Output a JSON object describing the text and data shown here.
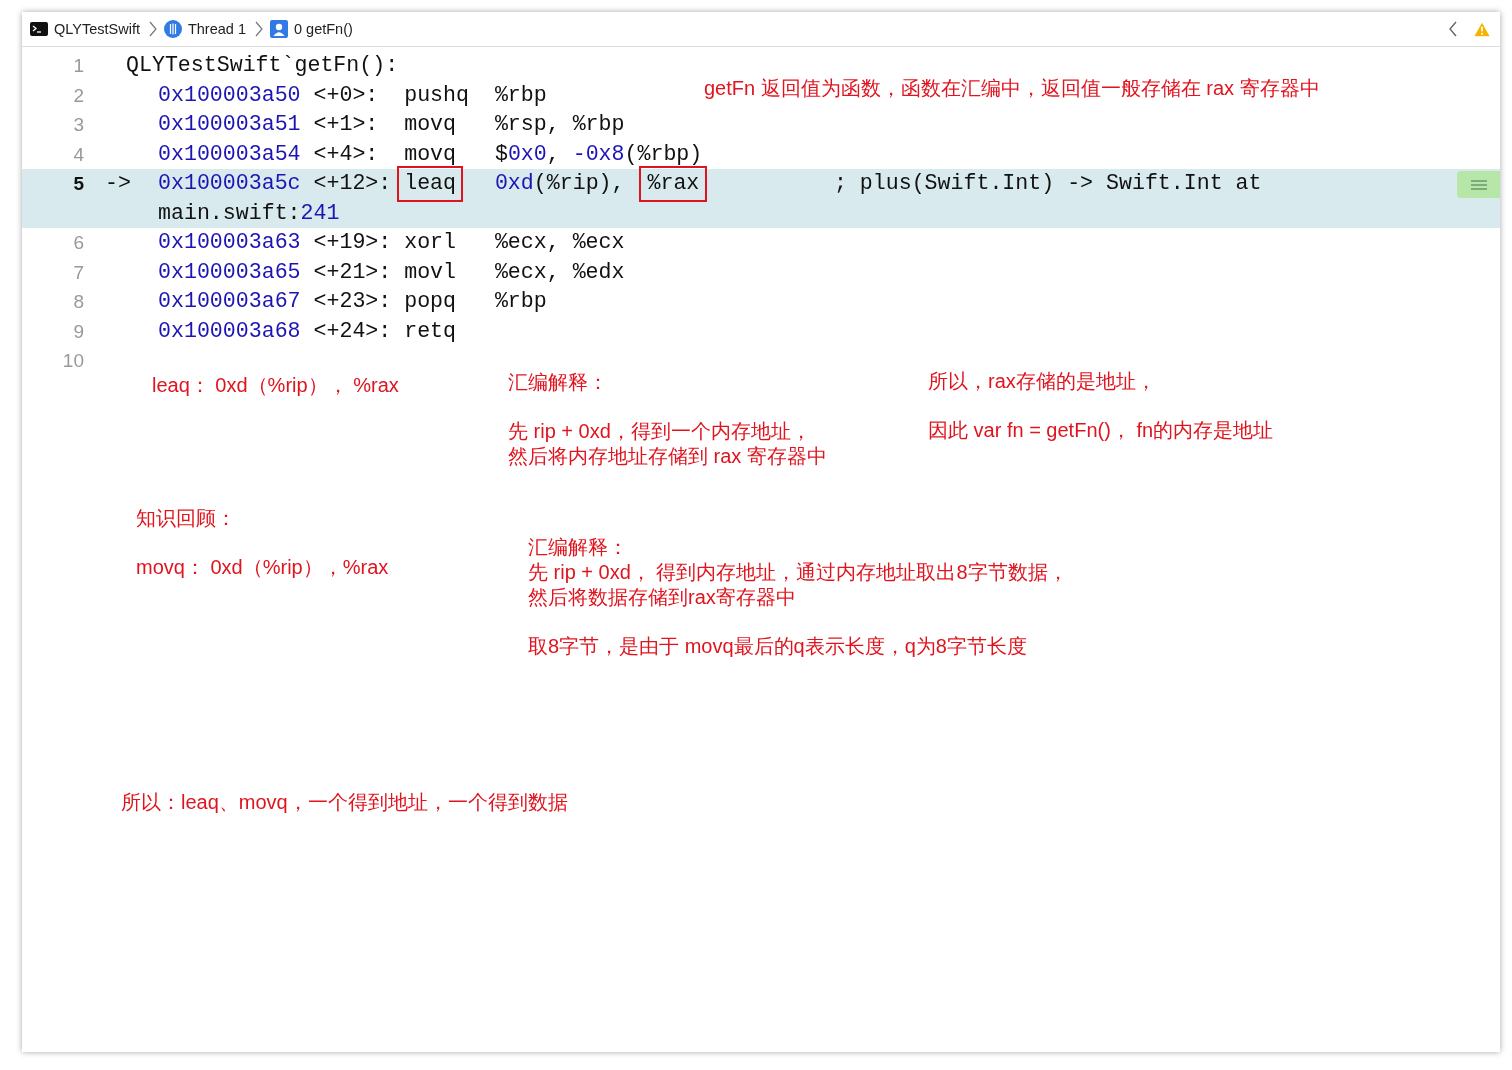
{
  "breadcrumb": {
    "items": [
      {
        "kind": "target",
        "label": "QLYTestSwift"
      },
      {
        "kind": "thread",
        "label": "Thread 1"
      },
      {
        "kind": "frame",
        "label": "0 getFn()"
      }
    ]
  },
  "code": {
    "lines": [
      {
        "number": "1",
        "current": false,
        "header": "QLYTestSwift`getFn():"
      },
      {
        "number": "2",
        "current": false,
        "address": "0x100003a50",
        "offset": "<+0>:",
        "mnemonic": "pushq",
        "mnemonic_boxed": false,
        "operands": [
          {
            "text": "%rbp",
            "kind": "plain"
          }
        ]
      },
      {
        "number": "3",
        "current": false,
        "address": "0x100003a51",
        "offset": "<+1>:",
        "mnemonic": "movq",
        "mnemonic_boxed": false,
        "operands": [
          {
            "text": "%rsp, %rbp",
            "kind": "plain"
          }
        ]
      },
      {
        "number": "4",
        "current": false,
        "address": "0x100003a54",
        "offset": "<+4>:",
        "mnemonic": "movq",
        "mnemonic_boxed": false,
        "operands": [
          {
            "text": "$",
            "kind": "plain"
          },
          {
            "text": "0x0",
            "kind": "number"
          },
          {
            "text": ", ",
            "kind": "plain"
          },
          {
            "text": "-0x8",
            "kind": "number"
          },
          {
            "text": "(%rbp)",
            "kind": "plain"
          }
        ]
      },
      {
        "number": "5",
        "current": true,
        "arrow": "->",
        "address": "0x100003a5c",
        "offset": "<+12>:",
        "mnemonic": "leaq",
        "mnemonic_boxed": true,
        "operands": [
          {
            "text": "0xd",
            "kind": "number"
          },
          {
            "text": "(%rip), ",
            "kind": "plain"
          },
          {
            "text": "%rax",
            "kind": "boxed"
          }
        ],
        "comment": "; plus(Swift.Int) -> Swift.Int at",
        "continuation": [
          {
            "text": "main.swift:",
            "kind": "plain"
          },
          {
            "text": "241",
            "kind": "number"
          }
        ]
      },
      {
        "number": "6",
        "current": false,
        "address": "0x100003a63",
        "offset": "<+19>:",
        "mnemonic": "xorl",
        "mnemonic_boxed": false,
        "operands": [
          {
            "text": "%ecx, %ecx",
            "kind": "plain"
          }
        ]
      },
      {
        "number": "7",
        "current": false,
        "address": "0x100003a65",
        "offset": "<+21>:",
        "mnemonic": "movl",
        "mnemonic_boxed": false,
        "operands": [
          {
            "text": "%ecx, %edx",
            "kind": "plain"
          }
        ]
      },
      {
        "number": "8",
        "current": false,
        "address": "0x100003a67",
        "offset": "<+23>:",
        "mnemonic": "popq",
        "mnemonic_boxed": false,
        "operands": [
          {
            "text": "%rbp",
            "kind": "plain"
          }
        ]
      },
      {
        "number": "9",
        "current": false,
        "address": "0x100003a68",
        "offset": "<+24>:",
        "mnemonic": "retq",
        "mnemonic_boxed": false
      },
      {
        "number": "10",
        "current": false
      }
    ]
  },
  "notes": [
    {
      "paragraphs": [
        [
          "getFn 返回值为函数，函数在汇编中，返回值一般存储在 rax 寄存器中"
        ]
      ]
    },
    {
      "paragraphs": [
        [
          "leaq： 0xd（%rip）， %rax"
        ]
      ]
    },
    {
      "paragraphs": [
        [
          "汇编解释："
        ],
        [
          "先 rip + 0xd，得到一个内存地址，",
          "然后将内存地址存储到 rax 寄存器中"
        ]
      ]
    },
    {
      "paragraphs": [
        [
          "所以，rax存储的是地址，"
        ],
        [
          "因此 var fn = getFn()， fn的内存是地址"
        ]
      ]
    },
    {
      "paragraphs": [
        [
          "知识回顾："
        ],
        [
          "movq： 0xd（%rip），%rax"
        ]
      ]
    },
    {
      "paragraphs": [
        [
          "汇编解释：",
          "先 rip + 0xd， 得到内存地址，通过内存地址取出8字节数据，",
          "然后将数据存储到rax寄存器中"
        ],
        [
          "取8字节，是由于 movq最后的q表示长度，q为8字节长度"
        ]
      ]
    },
    {
      "paragraphs": [
        [
          "所以：leaq、movq，一个得到地址，一个得到数据"
        ]
      ]
    }
  ]
}
